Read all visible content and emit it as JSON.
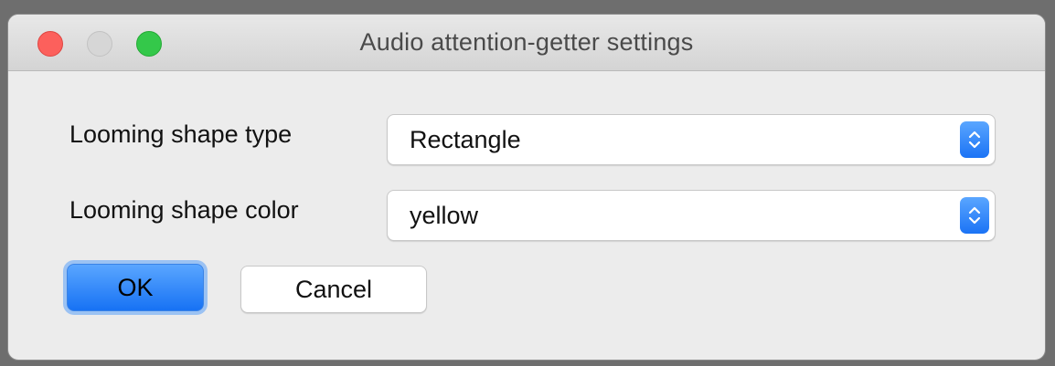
{
  "window": {
    "title": "Audio attention-getter settings"
  },
  "form": {
    "shape_type": {
      "label": "Looming shape type",
      "value": "Rectangle"
    },
    "shape_color": {
      "label": "Looming shape color",
      "value": "yellow"
    }
  },
  "buttons": {
    "ok_label": "OK",
    "cancel_label": "Cancel"
  },
  "colors": {
    "accent": "#1b73f5",
    "close": "#fc605c",
    "maximize": "#34c84a"
  },
  "icons": {
    "stepper": "chevron-up-down-icon"
  }
}
